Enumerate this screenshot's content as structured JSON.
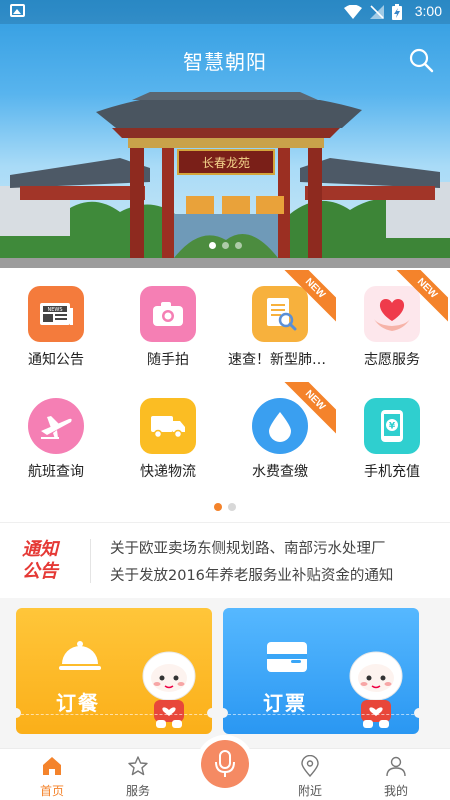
{
  "status_bar": {
    "time": "3:00"
  },
  "header": {
    "title": "智慧朝阳"
  },
  "hero": {
    "gate_plaque": "长春龙苑",
    "active_slide": 0,
    "slide_count": 3
  },
  "services": [
    {
      "label": "通知公告",
      "icon": "newspaper-icon",
      "color": "#f47b3c",
      "is_new": false
    },
    {
      "label": "随手拍",
      "icon": "camera-icon",
      "color": "#f57fb4",
      "is_new": false
    },
    {
      "label": "速查！新型肺炎确诊患者",
      "icon": "document-search-icon",
      "color": "#f7b13d",
      "is_new": true
    },
    {
      "label": "志愿服务",
      "icon": "heart-hands-icon",
      "color": "#fde7ec",
      "is_new": true
    },
    {
      "label": "航班查询",
      "icon": "airplane-icon",
      "color": "#f57fb4",
      "is_new": false
    },
    {
      "label": "快递物流",
      "icon": "truck-icon",
      "color": "#fbbd23",
      "is_new": false
    },
    {
      "label": "水费查缴",
      "icon": "water-drop-icon",
      "color": "#3a9ff0",
      "is_new": true
    },
    {
      "label": "手机充值",
      "icon": "phone-recharge-icon",
      "color": "#2fcfcf",
      "is_new": false
    }
  ],
  "new_badge": "NEW",
  "grid_pages": {
    "count": 2,
    "active": 0
  },
  "notice": {
    "logo_line1": "通知",
    "logo_line2": "公告",
    "items": [
      "关于欧亚卖场东侧规划路、南部污水处理厂",
      "关于发放2016年养老服务业补贴资金的通知"
    ]
  },
  "cards": [
    {
      "label": "订餐",
      "icon": "food-cloche-icon",
      "color": "#fbb322"
    },
    {
      "label": "订票",
      "icon": "ticket-icon",
      "color": "#3aa6f7"
    }
  ],
  "bottom_nav": {
    "items": [
      {
        "label": "首页",
        "icon": "home-icon",
        "active": true
      },
      {
        "label": "服务",
        "icon": "star-icon",
        "active": false
      },
      {
        "label": "附近",
        "icon": "location-pin-icon",
        "active": false
      },
      {
        "label": "我的",
        "icon": "user-icon",
        "active": false
      }
    ],
    "center_icon": "microphone-icon"
  },
  "colors": {
    "accent": "#f4832b",
    "notice_red": "#e53935"
  }
}
